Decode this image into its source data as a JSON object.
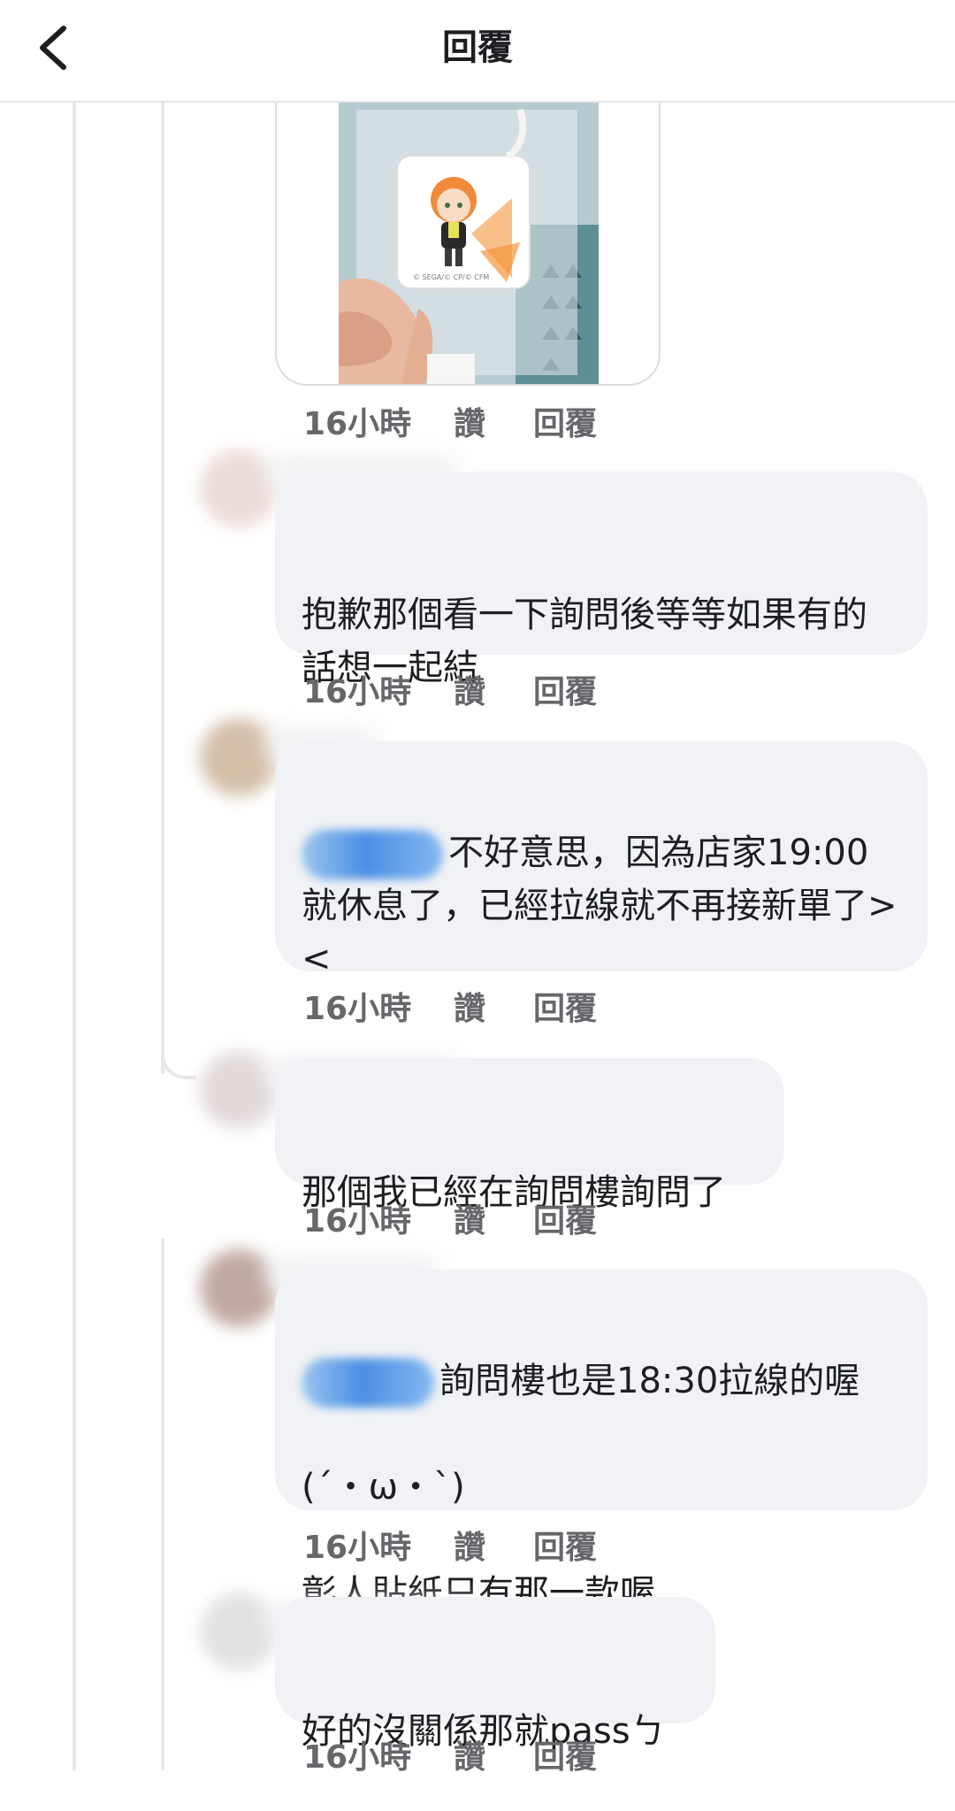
{
  "header": {
    "title": "回覆",
    "back_icon": "chevron-left-icon"
  },
  "photo": {
    "alt_icon": "photo-icon",
    "watermark": "© SEGA/© CP/© CFM"
  },
  "actions": {
    "like": "讚",
    "reply": "回覆"
  },
  "comments": [
    {
      "time": "16小時",
      "text": ""
    },
    {
      "time": "16小時",
      "text": "抱歉那個看一下詢問後等等如果有的話想一起結"
    },
    {
      "time": "16小時",
      "text": "不好意思，因為店家19:00就休息了，已經拉線就不再接新單了><",
      "has_mention": true
    },
    {
      "time": "16小時",
      "text": "那個我已經在詢問樓詢問了"
    },
    {
      "time": "16小時",
      "text_line1": "詢問樓也是18:30拉線的喔",
      "text_line2": "(´・ω・`)",
      "text_line3": "彰人貼紙只有那一款喔",
      "has_mention": true
    },
    {
      "time": "16小時",
      "text": "好的沒關係那就passㄅ"
    }
  ]
}
